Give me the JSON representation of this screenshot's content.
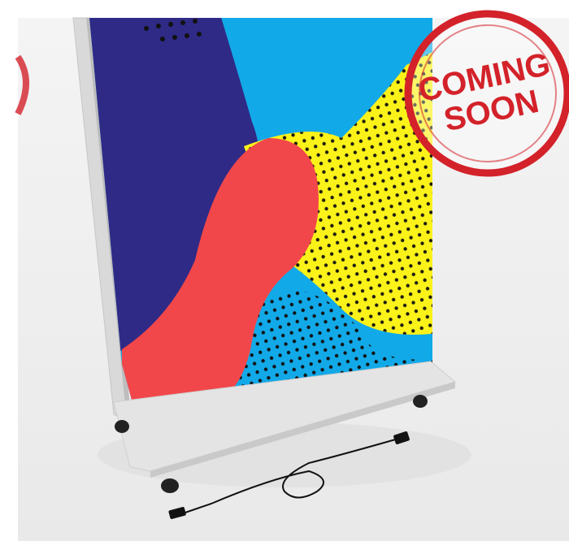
{
  "stamp": {
    "line1": "COMING",
    "line2": "SOON",
    "color": "#d3222a"
  },
  "colors": {
    "backdrop": "#efefef",
    "floor": "#e7e7e7",
    "frame": "#dcdcdc",
    "navy": "#2f2a86",
    "cyan": "#12a9e8",
    "red": "#f2474a",
    "yellow": "#fbf21a",
    "dots": "#111111"
  },
  "icons": [
    "light-box-display",
    "power-cable",
    "caster-wheel",
    "coming-soon-stamp"
  ]
}
